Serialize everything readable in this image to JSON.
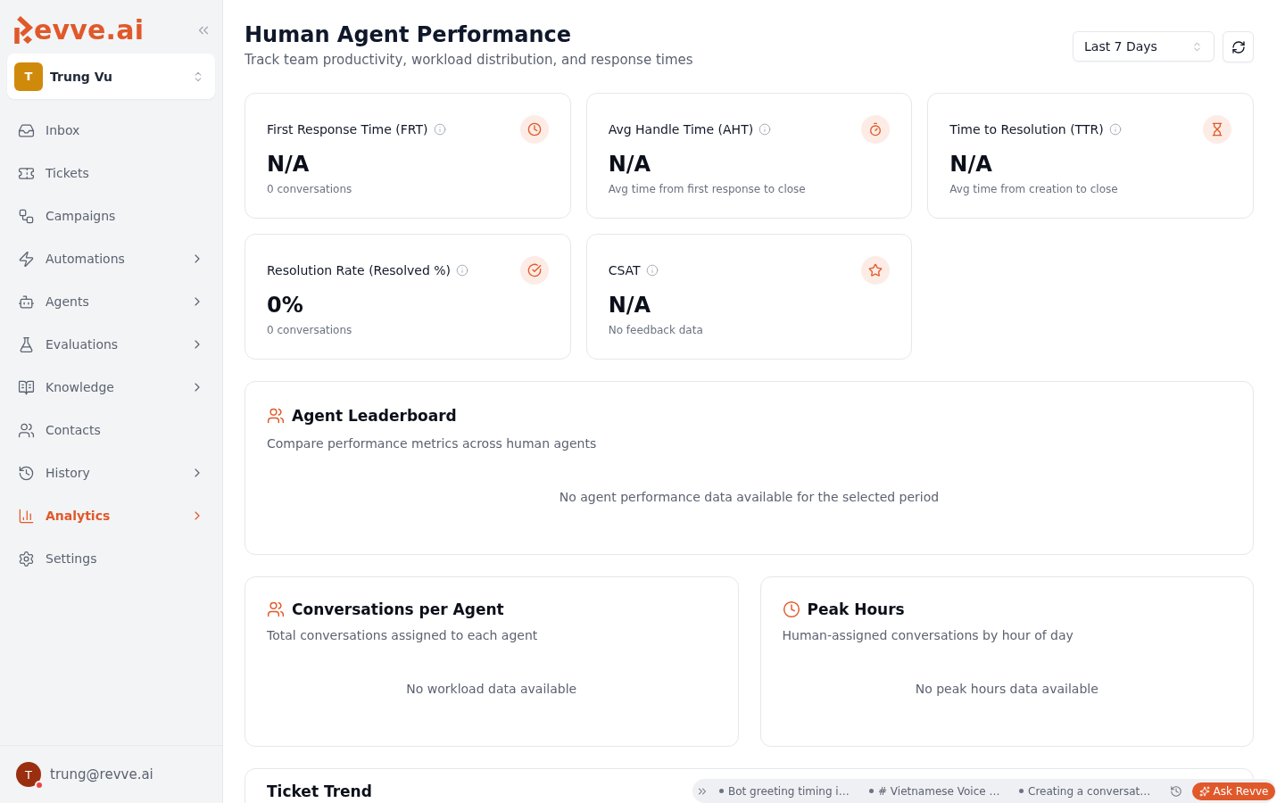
{
  "sidebar": {
    "brand": "evve.ai",
    "workspace": {
      "initial": "T",
      "name": "Trung Vu"
    },
    "items": [
      {
        "label": "Inbox",
        "selected": false,
        "has_submenu": false
      },
      {
        "label": "Tickets",
        "selected": false,
        "has_submenu": false
      },
      {
        "label": "Campaigns",
        "selected": false,
        "has_submenu": false
      },
      {
        "label": "Automations",
        "selected": false,
        "has_submenu": true
      },
      {
        "label": "Agents",
        "selected": false,
        "has_submenu": true
      },
      {
        "label": "Evaluations",
        "selected": false,
        "has_submenu": true
      },
      {
        "label": "Knowledge",
        "selected": false,
        "has_submenu": true
      },
      {
        "label": "Contacts",
        "selected": false,
        "has_submenu": false
      },
      {
        "label": "History",
        "selected": false,
        "has_submenu": true
      },
      {
        "label": "Analytics",
        "selected": true,
        "has_submenu": true
      },
      {
        "label": "Settings",
        "selected": false,
        "has_submenu": false
      }
    ],
    "user": {
      "initial": "T",
      "email": "trung@revve.ai",
      "status_dot": true
    }
  },
  "header": {
    "title": "Human Agent Performance",
    "subtitle": "Track team productivity, workload distribution, and response times",
    "date_range": "Last 7 Days"
  },
  "metrics": [
    {
      "title": "First Response Time (FRT)",
      "value": "N/A",
      "caption": "0 conversations"
    },
    {
      "title": "Avg Handle Time (AHT)",
      "value": "N/A",
      "caption": "Avg time from first response to close"
    },
    {
      "title": "Time to Resolution (TTR)",
      "value": "N/A",
      "caption": "Avg time from creation to close"
    },
    {
      "title": "Resolution Rate (Resolved %)",
      "value": "0%",
      "caption": "0 conversations"
    },
    {
      "title": "CSAT",
      "value": "N/A",
      "caption": "No feedback data"
    }
  ],
  "panels": [
    {
      "kind": "wide",
      "title": "Agent Leaderboard",
      "subtitle": "Compare performance metrics across human agents",
      "empty_message": "No agent performance data available for the selected period"
    },
    {
      "kind": "half",
      "title": "Conversations per Agent",
      "subtitle": "Total conversations assigned to each agent",
      "empty_message": "No workload data available"
    },
    {
      "kind": "half",
      "title": "Peak Hours",
      "subtitle": "Human-assigned conversations by hour of day",
      "empty_message": "No peak hours data available"
    },
    {
      "kind": "chart",
      "title": "Ticket Trend"
    }
  ],
  "assistant_bar": {
    "threads": [
      "Bot greeting timing i…",
      "# Vietnamese Voice …",
      "Creating a conversat…"
    ],
    "button": "Ask Revve"
  }
}
